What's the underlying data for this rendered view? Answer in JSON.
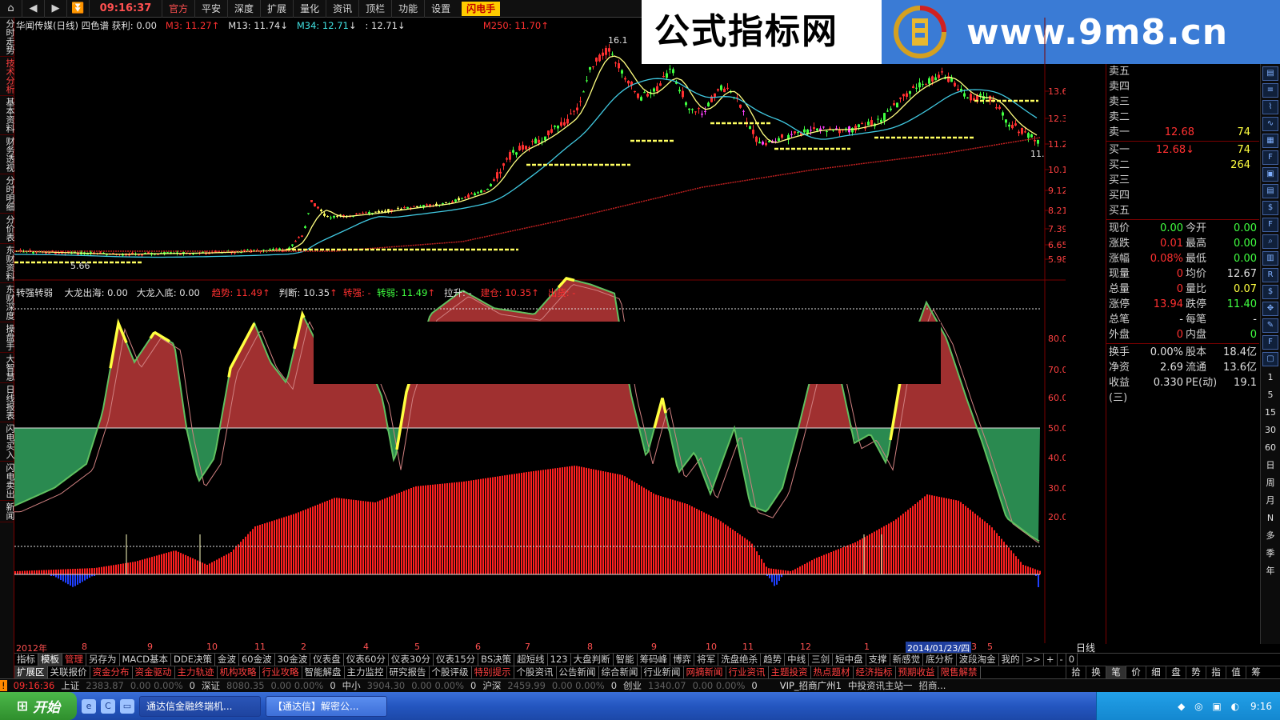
{
  "toolbar": {
    "clock": "09:16:37",
    "menus": [
      "官方",
      "平安",
      "深度",
      "扩展",
      "量化",
      "资讯",
      "顶栏",
      "功能",
      "设置"
    ],
    "flash_button": "闪电手"
  },
  "banner": {
    "title": "公式指标网",
    "url": "www.9m8.cn"
  },
  "left_tabs": [
    "分时走势",
    "技术分析",
    "基本资料",
    "财务透视",
    "分时明细",
    "分价表",
    "东财资料",
    "东财深度",
    "操盘手",
    "大智慧",
    "日线报表",
    "闪电买入",
    "闪电卖出",
    "新闻"
  ],
  "main_info": {
    "title": "华闻传媒(日线) 四色谱",
    "profit": "获利: 0.00",
    "m3": "M3: 11.27",
    "m13": "M13: 11.74",
    "m34": "M34: 12.71",
    "m34b": ": 12.71",
    "m250": "M250: 11.70",
    "peak_label": "16.1",
    "low_label": "5.66",
    "last_label": "11."
  },
  "price_axis": [
    "13.62",
    "12.39",
    "11.26",
    "10.13",
    "9.12",
    "8.21",
    "7.39",
    "6.65",
    "5.98"
  ],
  "ind_info": {
    "name": "转强转弱",
    "dlch": "大龙出海: 0.00",
    "dlrd": "大龙入底: 0.00",
    "trend": "趋势: 11.49",
    "judge": "判断: 10.35",
    "qiang": "转强: -",
    "ruo": "转弱: 11.49",
    "lift": "拉升: -",
    "build": "建仓: 10.35",
    "out": "出货: -"
  },
  "ind_axis": [
    "80.00",
    "70.00",
    "60.00",
    "50.00",
    "40.00",
    "30.00",
    "20.00"
  ],
  "date_axis": [
    "2012年",
    "8",
    "9",
    "10",
    "11",
    "2",
    "4",
    "5",
    "6",
    "7",
    "8",
    "9",
    "10",
    "11",
    "12",
    "1",
    "2014/01/23/四",
    "3",
    "5"
  ],
  "period": "日线",
  "order_book": {
    "sell": [
      {
        "label": "卖五",
        "price": "",
        "vol": ""
      },
      {
        "label": "卖四",
        "price": "",
        "vol": ""
      },
      {
        "label": "卖三",
        "price": "",
        "vol": ""
      },
      {
        "label": "卖二",
        "price": "",
        "vol": ""
      },
      {
        "label": "卖一",
        "price": "12.68",
        "vol": "74"
      }
    ],
    "buy": [
      {
        "label": "买一",
        "price": "12.68↓",
        "vol": "74"
      },
      {
        "label": "买二",
        "price": "",
        "vol": "264"
      },
      {
        "label": "买三",
        "price": "",
        "vol": ""
      },
      {
        "label": "买四",
        "price": "",
        "vol": ""
      },
      {
        "label": "买五",
        "price": "",
        "vol": ""
      }
    ]
  },
  "stats": [
    {
      "l1": "现价",
      "v1": "0.00",
      "c1": "c-g",
      "l2": "今开",
      "v2": "0.00",
      "c2": "c-g"
    },
    {
      "l1": "涨跌",
      "v1": "0.01",
      "c1": "c-r",
      "l2": "最高",
      "v2": "0.00",
      "c2": "c-g"
    },
    {
      "l1": "涨幅",
      "v1": "0.08%",
      "c1": "c-r",
      "l2": "最低",
      "v2": "0.00",
      "c2": "c-g"
    },
    {
      "l1": "现量",
      "v1": "0",
      "c1": "c-r",
      "l2": "均价",
      "v2": "12.67",
      "c2": "c-w"
    },
    {
      "l1": "总量",
      "v1": "0",
      "c1": "c-r",
      "l2": "量比",
      "v2": "0.07",
      "c2": "c-y"
    },
    {
      "l1": "涨停",
      "v1": "13.94",
      "c1": "c-r",
      "l2": "跌停",
      "v2": "11.40",
      "c2": "c-g"
    },
    {
      "l1": "总笔",
      "v1": "-",
      "c1": "c-w",
      "l2": "每笔",
      "v2": "-",
      "c2": "c-w"
    },
    {
      "l1": "外盘",
      "v1": "0",
      "c1": "c-r",
      "l2": "内盘",
      "v2": "0",
      "c2": "c-g"
    }
  ],
  "stats2": [
    {
      "l1": "换手",
      "v1": "0.00%",
      "l2": "股本",
      "v2": "18.4亿"
    },
    {
      "l1": "净资",
      "v1": "2.69",
      "l2": "流通",
      "v2": "13.6亿"
    },
    {
      "l1": "收益(三)",
      "v1": "0.330",
      "l2": "PE(动)",
      "v2": "19.1"
    }
  ],
  "icon_strip_text": [
    "1",
    "5",
    "15",
    "30",
    "60",
    "日",
    "周",
    "月",
    "N",
    "多",
    "季",
    "年"
  ],
  "tabs_row1": [
    "指标",
    "模板",
    "管理",
    "另存为",
    "MACD基本",
    "DDE决策",
    "金波",
    "60金波",
    "30金波",
    "仪表盘",
    "仪表60分",
    "仪表30分",
    "仪表15分",
    "BS决策",
    "超短线",
    "123",
    "大盘判断",
    "智能",
    "筹码峰",
    "博弈",
    "将军",
    "洗盘绝杀",
    "趋势",
    "中线",
    "三剑",
    "短中盘",
    "支撑",
    "新感觉",
    "底分析",
    "波段淘金",
    "我的",
    ">>",
    "+",
    "-",
    "0"
  ],
  "tabs_row2": [
    "扩展区",
    "关联报价",
    "资金分布",
    "资金驱动",
    "主力轨迹",
    "机构攻略",
    "行业攻略",
    "智能解盘",
    "主力监控",
    "研究报告",
    "个股评级",
    "特别提示",
    "个股资讯",
    "公告新闻",
    "综合新闻",
    "行业新闻",
    "网摘新闻",
    "行业资讯",
    "主题投资",
    "热点题材",
    "经济指标",
    "预期收益",
    "限售解禁"
  ],
  "right_tabs": [
    "拾",
    "换",
    "笔",
    "价",
    "细",
    "盘",
    "势",
    "指",
    "值",
    "筹"
  ],
  "status": {
    "time": "09:16:36",
    "sh": "上证",
    "sh_val": "2383.87",
    "sh_chg": "0.00  0.00%",
    "sh_vol": "0",
    "sz": "深证",
    "sz_val": "8080.35",
    "sz_chg": "0.00  0.00%",
    "sz_vol": "0",
    "zx": "中小",
    "zx_val": "3904.30",
    "zx_chg": "0.00  0.00%",
    "zx_vol": "0",
    "hs": "沪深",
    "hs_val": "2459.99",
    "hs_chg": "0.00  0.00%",
    "hs_vol": "0",
    "cy": "创业",
    "cy_val": "1340.07",
    "cy_chg": "0.00  0.00%",
    "cy_vol": "0",
    "vip": "VIP_招商广州1",
    "site": "中投资讯主站一",
    "broker": "招商..."
  },
  "taskbar": {
    "start": "开始",
    "tasks": [
      "通达信金融终端机...",
      "【通达信】解密公..."
    ],
    "clock": "9:16"
  },
  "colors": {
    "up": "#ff3030",
    "down": "#40ff40",
    "ma_yellow": "#ffff80",
    "ma_cyan": "#40c8e0",
    "m250": "#c02020",
    "ind_fill_red": "#a03030",
    "ind_fill_green": "#2a8a50",
    "ind_bar": "#ff2020"
  }
}
